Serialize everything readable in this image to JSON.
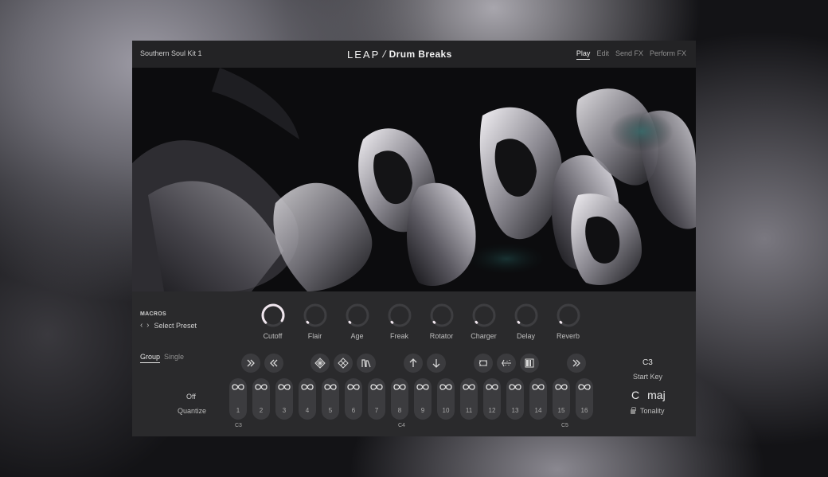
{
  "header": {
    "preset_name": "Southern Soul Kit 1",
    "logo": {
      "leap": "LEAP",
      "brand": "Drum Breaks"
    },
    "nav": [
      {
        "label": "Play",
        "active": true
      },
      {
        "label": "Edit",
        "active": false
      },
      {
        "label": "Send FX",
        "active": false
      },
      {
        "label": "Perform FX",
        "active": false
      }
    ]
  },
  "macros": {
    "title": "MACROS",
    "select_preset": "Select Preset",
    "knobs": [
      {
        "label": "Cutoff",
        "value": 0.95
      },
      {
        "label": "Flair",
        "value": 0.02
      },
      {
        "label": "Age",
        "value": 0.02
      },
      {
        "label": "Freak",
        "value": 0.02
      },
      {
        "label": "Rotator",
        "value": 0.02
      },
      {
        "label": "Charger",
        "value": 0.02
      },
      {
        "label": "Delay",
        "value": 0.02
      },
      {
        "label": "Reverb",
        "value": 0.02
      }
    ]
  },
  "mode": {
    "group": "Group",
    "single": "Single",
    "active": "Group"
  },
  "quantize": {
    "value": "Off",
    "label": "Quantize"
  },
  "tools": [
    {
      "icon": "fast-forward-icon"
    },
    {
      "icon": "rewind-icon"
    },
    {
      "icon": "grid-diamond-icon"
    },
    {
      "icon": "grid-diamond-alt-icon"
    },
    {
      "icon": "envelope-icon"
    },
    {
      "icon": "arrow-up-icon"
    },
    {
      "icon": "arrow-down-icon"
    },
    {
      "icon": "loop-icon"
    },
    {
      "icon": "scatter-icon"
    },
    {
      "icon": "slices-icon"
    },
    {
      "icon": "fast-forward-icon"
    }
  ],
  "pads": [
    "1",
    "2",
    "3",
    "4",
    "5",
    "6",
    "7",
    "8",
    "9",
    "10",
    "11",
    "12",
    "13",
    "14",
    "15",
    "16"
  ],
  "notes": [
    "C3",
    "C4",
    "C5"
  ],
  "start_key": {
    "value": "C3",
    "label": "Start Key"
  },
  "tonality": {
    "root": "C",
    "scale": "maj",
    "label": "Tonality"
  },
  "colors": {
    "accent": "#f0e6ee",
    "panel": "#2a2a2c",
    "header": "#232325"
  }
}
